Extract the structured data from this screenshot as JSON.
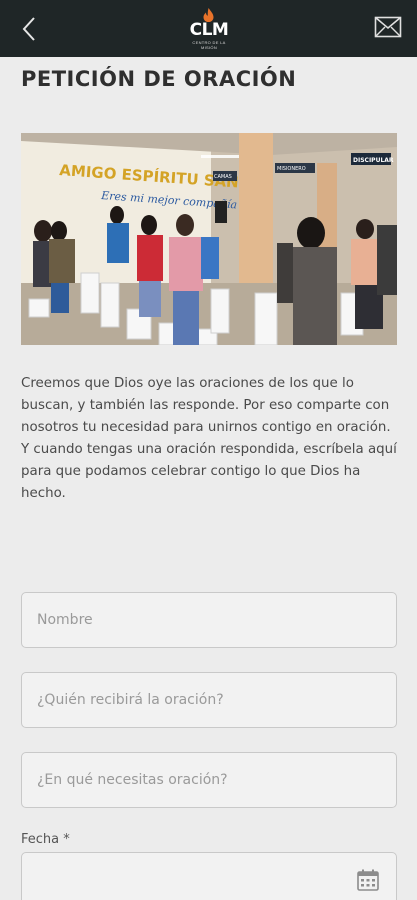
{
  "header": {
    "back_label": "Back",
    "logo_text": "CLM",
    "logo_subtext": "CENTRO DE LA MISIÓN",
    "icons": [
      "chevron-left-icon",
      "flame-icon",
      "mail-icon"
    ]
  },
  "page": {
    "title": "PETICIÓN DE ORACIÓN",
    "photo_alt": "Personas orando en una iglesia",
    "photo_banner_line1": "AMIGO ESPÍRITU SANT",
    "photo_banner_line2": "Eres mi mejor compañía",
    "photo_sign_1": "DISCIPULAR",
    "photo_sign_2": "CAMAS",
    "photo_sign_3": "MISIONERO",
    "intro_text": "Creemos que Dios oye las oraciones de los que lo buscan, y también las responde. Por eso comparte con nosotros tu necesidad para unirnos contigo en oración. Y cuando tengas una oración respondida, escríbela aquí para que podamos celebrar contigo lo que Dios ha hecho."
  },
  "form": {
    "name": {
      "placeholder": "Nombre",
      "value": ""
    },
    "recipient": {
      "placeholder": "¿Quién recibirá la oración?",
      "value": ""
    },
    "need": {
      "placeholder": "¿En qué necesitas oración?",
      "value": ""
    },
    "date": {
      "label": "Fecha *",
      "value": "",
      "icon": "calendar-icon"
    }
  },
  "colors": {
    "header_bg": "#1f2627",
    "flame": "#e8732a",
    "page_bg": "#ececec",
    "title": "#2f2f2f",
    "field_border": "#c9c9c9"
  }
}
